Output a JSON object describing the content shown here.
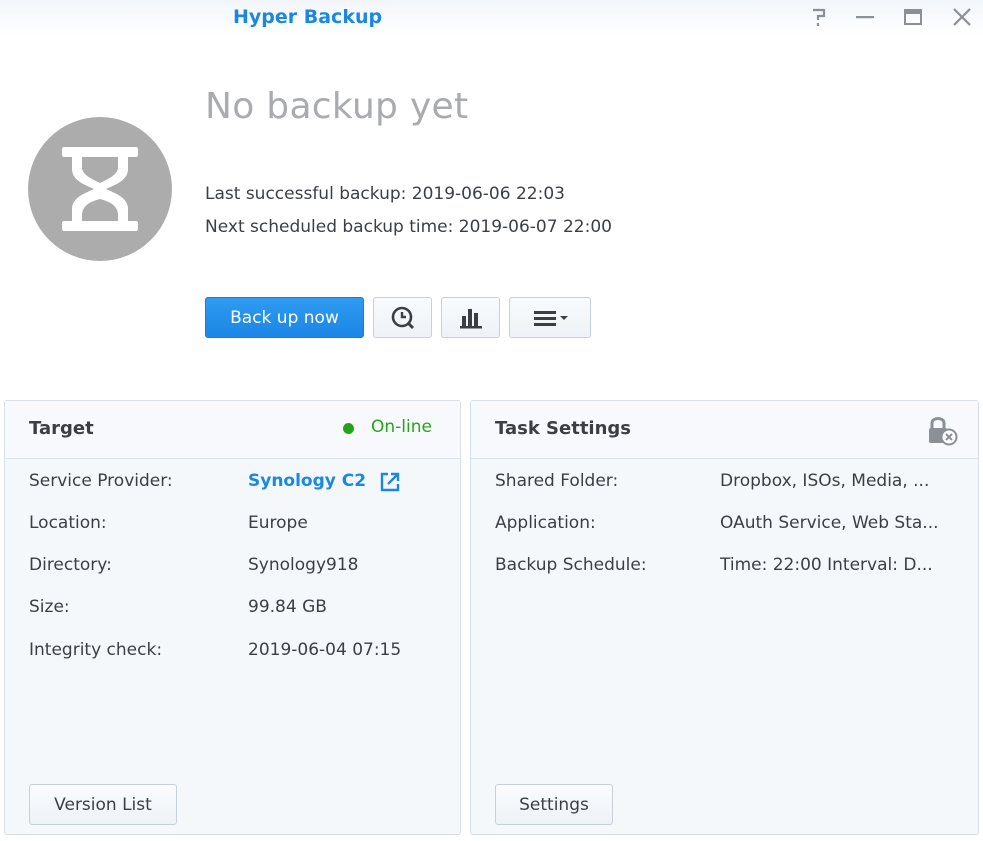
{
  "window": {
    "title": "Hyper Backup",
    "controls": [
      "help-icon",
      "minimize-icon",
      "maximize-icon",
      "close-icon"
    ]
  },
  "status": {
    "icon": "hourglass-icon",
    "title": "No backup yet",
    "last_backup": "Last successful backup: 2019-06-06 22:03",
    "next_backup": "Next scheduled backup time: 2019-06-07 22:00"
  },
  "actions": {
    "backup_now": "Back up now",
    "icons": [
      "history-icon",
      "statistics-icon",
      "menu-icon"
    ]
  },
  "target": {
    "title": "Target",
    "status": "On-line",
    "rows": [
      {
        "label": "Service Provider:",
        "value": "Synology C2"
      },
      {
        "label": "Location:",
        "value": "Europe"
      },
      {
        "label": "Directory:",
        "value": "Synology918"
      },
      {
        "label": "Size:",
        "value": "99.84 GB"
      },
      {
        "label": "Integrity check:",
        "value": "2019-06-04 07:15"
      }
    ],
    "button": "Version List"
  },
  "task": {
    "title": "Task Settings",
    "rows": [
      {
        "label": "Shared Folder:",
        "value": "Dropbox, ISOs, Media, ..."
      },
      {
        "label": "Application:",
        "value": "OAuth Service, Web Sta..."
      },
      {
        "label": "Backup Schedule:",
        "value": "Time: 22:00 Interval: D..."
      }
    ],
    "button": "Settings"
  },
  "colors": {
    "accent": "#1b88e0",
    "online": "#27a318",
    "status_circle": "#acacac"
  }
}
